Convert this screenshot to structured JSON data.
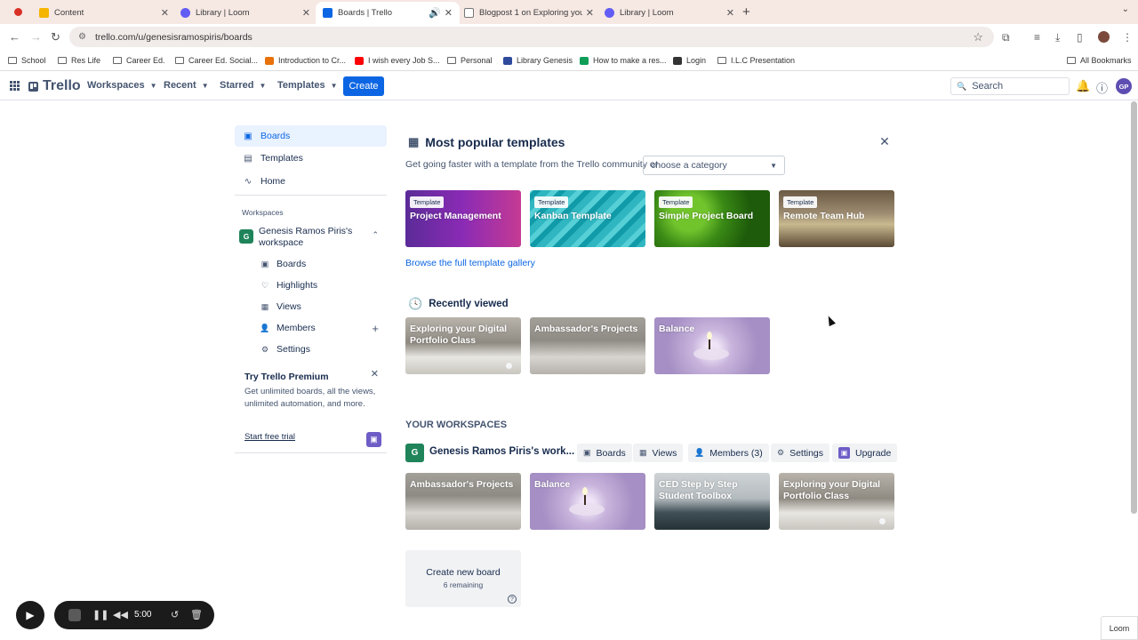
{
  "browser": {
    "tabs": [
      {
        "title": "Content",
        "favicon_color": "#f4b400"
      },
      {
        "title": "Library | Loom",
        "favicon_color": "#625df5"
      },
      {
        "title": "Boards | Trello",
        "favicon_color": "#0c66e4"
      },
      {
        "title": "Blogpost 1 on Exploring your",
        "favicon_color": "#777777"
      },
      {
        "title": "Library | Loom",
        "favicon_color": "#625df5"
      }
    ],
    "url": "trello.com/u/genesisramospiris/boards",
    "bookmarks": [
      {
        "label": "School",
        "type": "folder"
      },
      {
        "label": "Res Life",
        "type": "folder"
      },
      {
        "label": "Career Ed.",
        "type": "folder"
      },
      {
        "label": "Career Ed. Social...",
        "type": "folder"
      },
      {
        "label": "Introduction to Cr...",
        "type": "site",
        "color": "#e8710a"
      },
      {
        "label": "I wish every Job S...",
        "type": "site",
        "color": "#ff0000"
      },
      {
        "label": "Personal",
        "type": "folder"
      },
      {
        "label": "Library Genesis",
        "type": "site",
        "color": "#2e4a9c"
      },
      {
        "label": "How to make a res...",
        "type": "site",
        "color": "#0f9d58"
      },
      {
        "label": "Login",
        "type": "site",
        "color": "#333333"
      },
      {
        "label": "I.L.C Presentation",
        "type": "folder"
      }
    ],
    "all_bookmarks": "All Bookmarks"
  },
  "header": {
    "logo": "Trello",
    "menu": [
      "Workspaces",
      "Recent",
      "Starred",
      "Templates"
    ],
    "create_label": "Create",
    "search_placeholder": "Search",
    "avatar_initials": "GP"
  },
  "sidebar": {
    "items": [
      "Boards",
      "Templates",
      "Home"
    ],
    "workspaces_heading": "Workspaces",
    "workspace_name": "Genesis Ramos Piris's workspace",
    "workspace_initial": "G",
    "sub_items": [
      "Boards",
      "Highlights",
      "Views",
      "Members",
      "Settings"
    ],
    "premium": {
      "title": "Try Trello Premium",
      "description": "Get unlimited boards, all the views, unlimited automation, and more.",
      "cta": "Start free trial"
    }
  },
  "templates": {
    "title": "Most popular templates",
    "subtitle": "Get going faster with a template from the Trello community or",
    "category_placeholder": "choose a category",
    "badge": "Template",
    "tiles": [
      "Project Management",
      "Kanban Template",
      "Simple Project Board",
      "Remote Team Hub"
    ],
    "browse_link": "Browse the full template gallery"
  },
  "recent": {
    "title": "Recently viewed",
    "boards": [
      "Exploring your Digital Portfolio Class",
      "Ambassador's Projects",
      "Balance"
    ]
  },
  "workspaces": {
    "heading": "YOUR WORKSPACES",
    "name": "Genesis Ramos Piris's work...",
    "buttons": [
      "Boards",
      "Views",
      "Members (3)",
      "Settings",
      "Upgrade"
    ],
    "boards": [
      "Ambassador's Projects",
      "Balance",
      "CED Step by Step Student Toolbox",
      "Exploring your Digital Portfolio Class"
    ],
    "create_board": "Create new board",
    "remaining": "6 remaining"
  },
  "loom": {
    "timer": "5:00",
    "badge": "Loom"
  }
}
